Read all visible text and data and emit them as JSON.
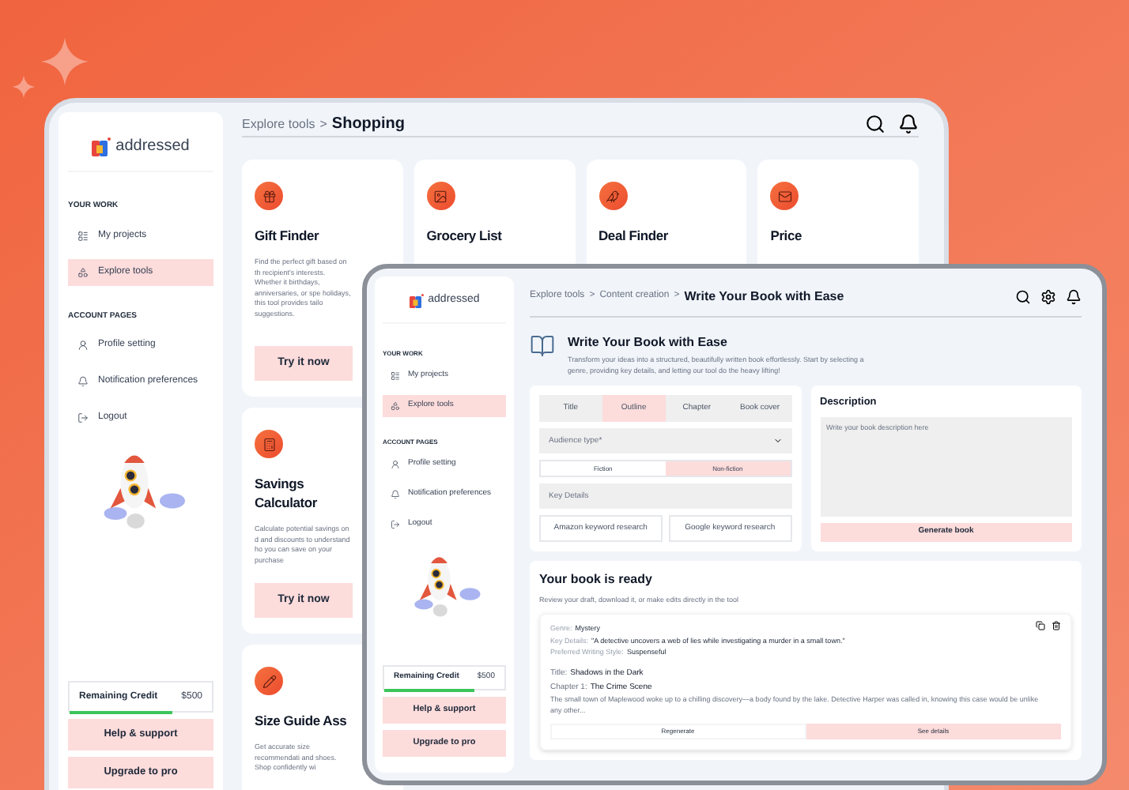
{
  "background_window": {
    "sidebar": {
      "logo": "addressed",
      "sections": [
        {
          "heading": "YOUR WORK",
          "items": [
            {
              "label": "My projects",
              "selected": false
            },
            {
              "label": "Explore tools",
              "selected": true
            }
          ]
        },
        {
          "heading": "ACCOUNT PAGES",
          "items": [
            {
              "label": "Profile setting",
              "selected": false
            },
            {
              "label": "Notification preferences",
              "selected": false
            },
            {
              "label": "Logout",
              "selected": false
            }
          ]
        }
      ],
      "credit": {
        "label": "Remaining Credit",
        "amount": "$500",
        "level": 0.72
      },
      "buttons": [
        "Help & support",
        "Upgrade to pro"
      ]
    },
    "breadcrumb": {
      "parents": [
        "Explore tools"
      ],
      "separator": ">",
      "current": "Shopping"
    },
    "cards": [
      {
        "title": "Gift Finder",
        "description": "Find the perfect gift based on th recipient's interests. Whether it birthdays, anniversaries, or spe holidays, this tool provides tailo suggestions.",
        "button": "Try it now"
      },
      {
        "title": "Grocery List"
      },
      {
        "title": "Deal Finder"
      },
      {
        "title": "Price"
      },
      {
        "title": "Savings Calculator",
        "description": "Calculate potential savings on d and discounts to understand ho you can save on your purchase",
        "button": "Try it now"
      },
      {
        "title": "Size Guide Ass",
        "description": "Get accurate size recommendati and shoes. Shop confidently wi"
      }
    ]
  },
  "front_window": {
    "sidebar": {
      "logo": "addressed",
      "sections": [
        {
          "heading": "YOUR WORK",
          "items": [
            {
              "label": "My projects",
              "selected": false
            },
            {
              "label": "Explore tools",
              "selected": true
            }
          ]
        },
        {
          "heading": "ACCOUNT PAGES",
          "items": [
            {
              "label": "Profile setting",
              "selected": false
            },
            {
              "label": "Notification preferences",
              "selected": false
            },
            {
              "label": "Logout",
              "selected": false
            }
          ]
        }
      ],
      "credit": {
        "label": "Remaining Credit",
        "amount": "$500",
        "level": 0.75
      },
      "buttons": [
        "Help & support",
        "Upgrade to pro"
      ]
    },
    "breadcrumb": {
      "parents": [
        "Explore tools",
        "Content creation"
      ],
      "separator": ">",
      "current": "Write Your Book with Ease"
    },
    "intro": {
      "title": "Write Your Book with Ease",
      "description": "Transform your ideas into a structured, beautifully written book effortlessly. Start by selecting a genre, providing key details, and letting our tool do the heavy lifting!"
    },
    "tabs": [
      {
        "label": "Title",
        "selected": false
      },
      {
        "label": "Outline",
        "selected": true
      },
      {
        "label": "Chapter",
        "selected": false
      },
      {
        "label": "Book cover",
        "selected": false
      }
    ],
    "audience": {
      "placeholder": "Audience type*"
    },
    "genre_toggle": [
      {
        "label": "Fiction",
        "selected": false
      },
      {
        "label": "Non-fiction",
        "selected": true
      }
    ],
    "key_details": {
      "placeholder": "Key Details"
    },
    "research_buttons": [
      "Amazon keyword research",
      "Google keyword research"
    ],
    "description": {
      "heading": "Description",
      "placeholder": "Write your book description here"
    },
    "generate_button": "Generate book",
    "result": {
      "title": "Your book is ready",
      "subtitle": "Review your draft, download it, or make edits directly in the tool",
      "fields": [
        {
          "label": "Genre:",
          "value": "Mystery"
        },
        {
          "label": "Key Details:",
          "value": "\"A detective uncovers a web of lies while investigating a murder in a small town.\""
        },
        {
          "label": "Preferred Writing Style:",
          "value": "Suspenseful"
        }
      ],
      "book": [
        {
          "label": "Title:",
          "value": "Shadows in the Dark"
        },
        {
          "label": "Chapter 1:",
          "value": "The Crime Scene"
        }
      ],
      "excerpt": "The small town of Maplewood woke up to a chilling discovery—a body found by the lake. Detective Harper was called in, knowing this case would be unlike any other...",
      "actions": [
        {
          "label": "Regenerate",
          "kind": "secondary"
        },
        {
          "label": "See details",
          "kind": "primary"
        }
      ]
    }
  }
}
